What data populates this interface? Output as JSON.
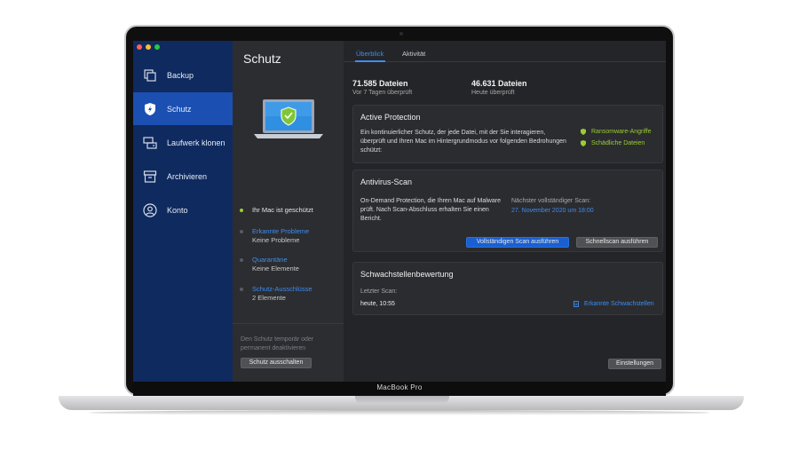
{
  "device": {
    "label": "MacBook Pro"
  },
  "sidebar": {
    "items": [
      {
        "label": "Backup",
        "icon": "backup-icon"
      },
      {
        "label": "Schutz",
        "icon": "shield-bolt-icon"
      },
      {
        "label": "Laufwerk klonen",
        "icon": "clone-disk-icon"
      },
      {
        "label": "Archivieren",
        "icon": "archive-box-icon"
      },
      {
        "label": "Konto",
        "icon": "account-icon"
      }
    ]
  },
  "protection_panel": {
    "title": "Schutz",
    "status": "Ihr Mac ist geschützt",
    "detected_problems": {
      "label": "Erkannte Probleme",
      "value": "Keine Probleme"
    },
    "quarantine": {
      "label": "Quarantäne",
      "value": "Keine Elemente"
    },
    "exclusions": {
      "label": "Schutz-Ausschlüsse",
      "value": "2 Elemente"
    },
    "footnote": "Den Schutz temporär oder permanent deaktivieren",
    "disable_button": "Schutz ausschalten"
  },
  "main": {
    "tabs": [
      {
        "label": "Überblick",
        "active": true
      },
      {
        "label": "Aktivität",
        "active": false
      }
    ],
    "stats": [
      {
        "value": "71.585 Dateien",
        "caption": "Vor 7 Tagen überprüft"
      },
      {
        "value": "46.631 Dateien",
        "caption": "Heute überprüft"
      }
    ],
    "active_protection": {
      "title": "Active Protection",
      "text": "Ein kontinuierlicher Schutz, der jede Datei, mit der Sie interagieren, überprüft und Ihren Mac im Hintergrundmodus vor folgenden Bedrohungen schützt:",
      "threats": [
        "Ransomware-Angriffe",
        "Schädliche Dateien"
      ]
    },
    "antivirus": {
      "title": "Antivirus-Scan",
      "text": "On-Demand Protection, die Ihren Mac auf Malware prüft. Nach Scan-Abschluss erhalten Sie einen Bericht.",
      "next_scan_label": "Nächster vollständiger Scan:",
      "next_scan_value": "27. November 2020 um 18:00",
      "full_scan_button": "Vollständigen Scan ausführen",
      "quick_scan_button": "Schnellscan ausführen"
    },
    "vulnerability": {
      "title": "Schwachstellenbewertung",
      "last_scan_label": "Letzter Scan:",
      "last_scan_value": "heute, 10:55",
      "detected_link": "Erkannte Schwachstellen"
    },
    "settings_button": "Einstellungen"
  },
  "colors": {
    "sidebar_bg": "#0f2a5e",
    "sidebar_active": "#1b50b2",
    "accent_blue": "#3d8df0",
    "status_green": "#9acd32"
  }
}
